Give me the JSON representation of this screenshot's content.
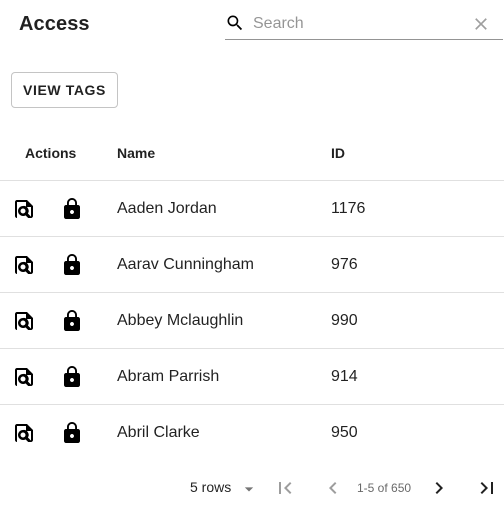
{
  "header": {
    "title": "Access"
  },
  "search": {
    "placeholder": "Search",
    "value": "",
    "icon": "search-icon",
    "clear_icon": "close-icon"
  },
  "toolbar": {
    "view_tags_label": "VIEW TAGS"
  },
  "table": {
    "columns": {
      "actions": "Actions",
      "name": "Name",
      "id": "ID"
    },
    "rows": [
      {
        "name": "Aaden Jordan",
        "id": "1176"
      },
      {
        "name": "Aarav Cunningham",
        "id": "976"
      },
      {
        "name": "Abbey Mclaughlin",
        "id": "990"
      },
      {
        "name": "Abram Parrish",
        "id": "914"
      },
      {
        "name": "Abril Clarke",
        "id": "950"
      }
    ],
    "row_actions": [
      "view-details-icon",
      "lock-icon"
    ]
  },
  "pagination": {
    "rows_per_page": "5 rows",
    "range": "1-5 of 650",
    "icons": [
      "first-page-icon",
      "previous-page-icon",
      "next-page-icon",
      "last-page-icon"
    ]
  },
  "colors": {
    "text": "#212121",
    "border": "#e0e0e0",
    "icon": "#000000"
  }
}
